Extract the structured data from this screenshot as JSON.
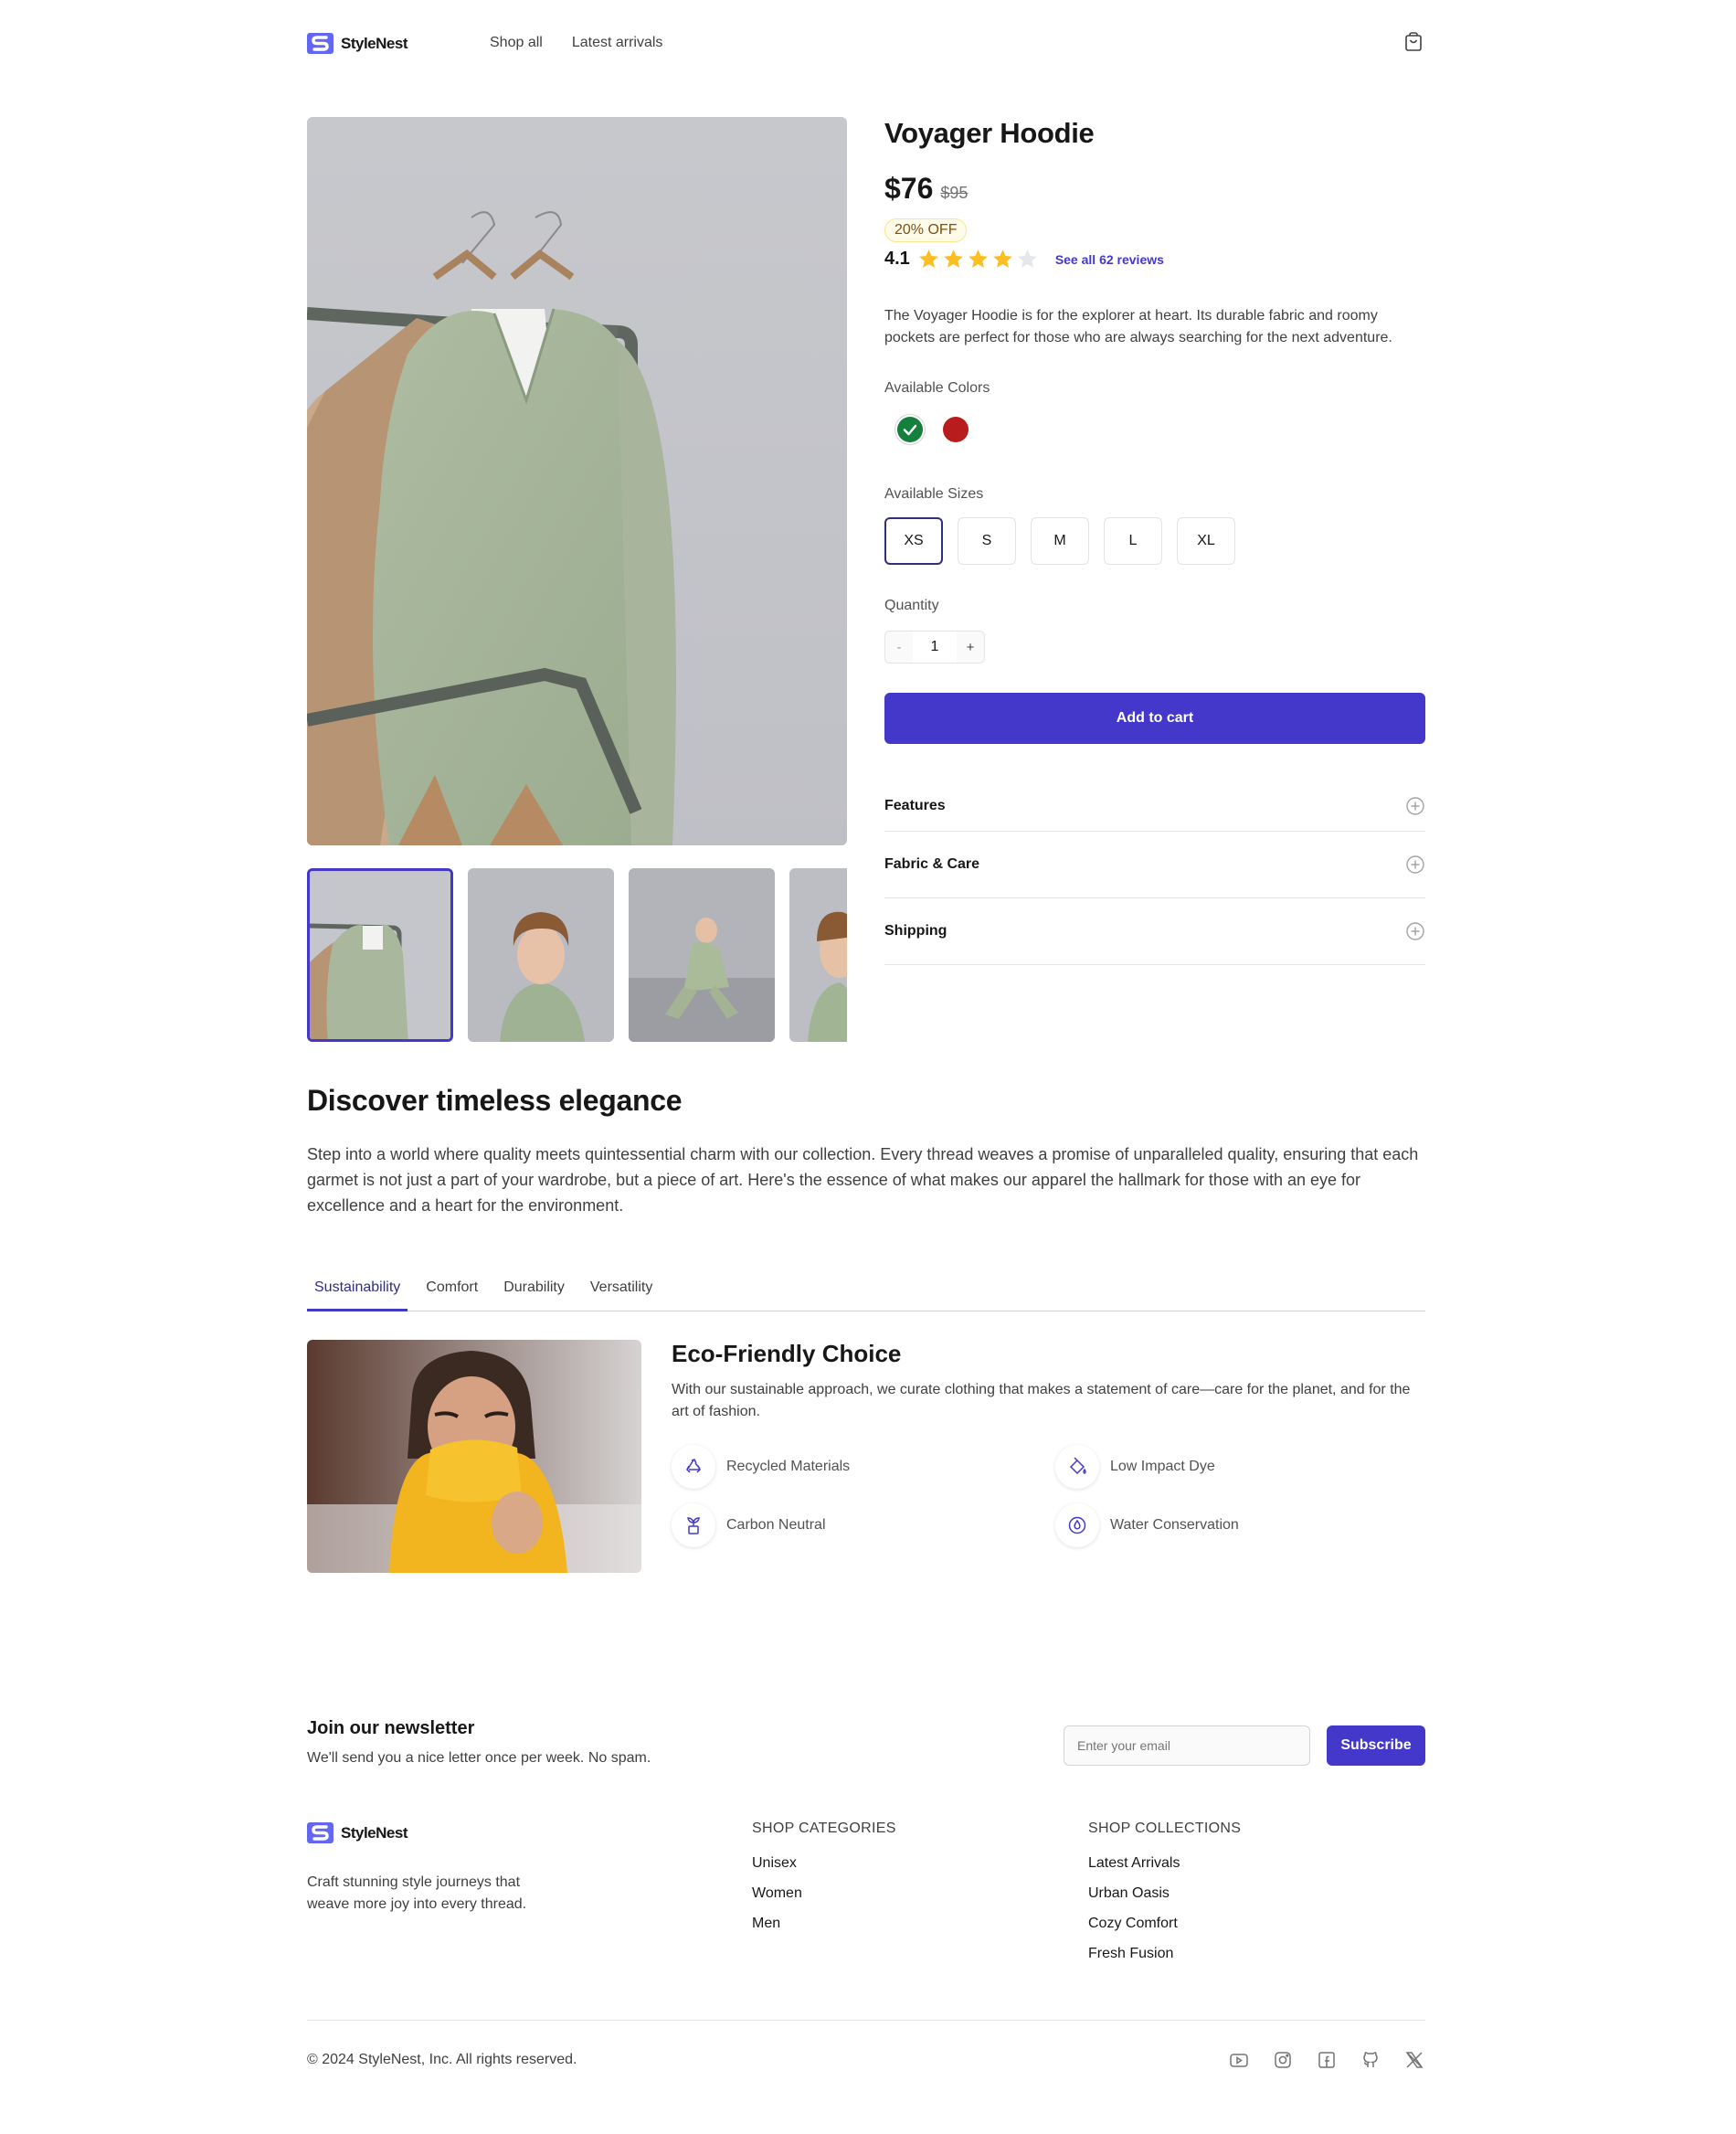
{
  "brand": {
    "name": "StyleNest",
    "accent": "#4338ca"
  },
  "nav": {
    "items": [
      "Shop all",
      "Latest arrivals"
    ]
  },
  "product": {
    "title": "Voyager Hoodie",
    "price": "$76",
    "old_price": "$95",
    "discount": "20% OFF",
    "rating": "4.1",
    "stars": 4,
    "reviews_link": "See all 62 reviews",
    "description": "The Voyager Hoodie is for the explorer at heart. Its durable fabric and roomy pockets are perfect for those who are always searching for the next adventure.",
    "colors_label": "Available Colors",
    "colors": [
      "#15803d",
      "#b91c1c"
    ],
    "sizes_label": "Available Sizes",
    "sizes": [
      "XS",
      "S",
      "M",
      "L",
      "XL"
    ],
    "selected_size": "XS",
    "quantity_label": "Quantity",
    "quantity": "1",
    "minus": "-",
    "plus": "+",
    "add_to_cart": "Add to cart",
    "accordion": [
      "Features",
      "Fabric & Care",
      "Shipping"
    ]
  },
  "discover": {
    "title": "Discover timeless elegance",
    "text": "Step into a world where quality meets quintessential charm with our collection. Every thread weaves a promise of unparalleled quality, ensuring that each garmet is not just a part of your wardrobe, but a piece of art. Here's the essence of what makes our apparel the hallmark for those with an eye for excellence and a heart for the environment.",
    "tabs": [
      "Sustainability",
      "Comfort",
      "Durability",
      "Versatility"
    ],
    "active_tab": "Sustainability",
    "panel": {
      "title": "Eco-Friendly Choice",
      "desc": "With our sustainable approach, we curate clothing that makes a statement of care—care for the planet, and for the art of fashion.",
      "features": [
        "Recycled Materials",
        "Low Impact Dye",
        "Carbon Neutral",
        "Water Conservation"
      ]
    }
  },
  "newsletter": {
    "title": "Join our newsletter",
    "subtitle": "We'll send you a nice letter once per week. No spam.",
    "placeholder": "Enter your email",
    "button": "Subscribe"
  },
  "footer": {
    "tagline": "Craft stunning style journeys that weave more joy into every thread.",
    "categories_head": "SHOP CATEGORIES",
    "categories": [
      "Unisex",
      "Women",
      "Men"
    ],
    "collections_head": "SHOP COLLECTIONS",
    "collections": [
      "Latest Arrivals",
      "Urban Oasis",
      "Cozy Comfort",
      "Fresh Fusion"
    ],
    "copyright": "© 2024 StyleNest, Inc. All rights reserved.",
    "socials": [
      "youtube-icon",
      "instagram-icon",
      "facebook-icon",
      "github-icon",
      "x-icon"
    ]
  }
}
